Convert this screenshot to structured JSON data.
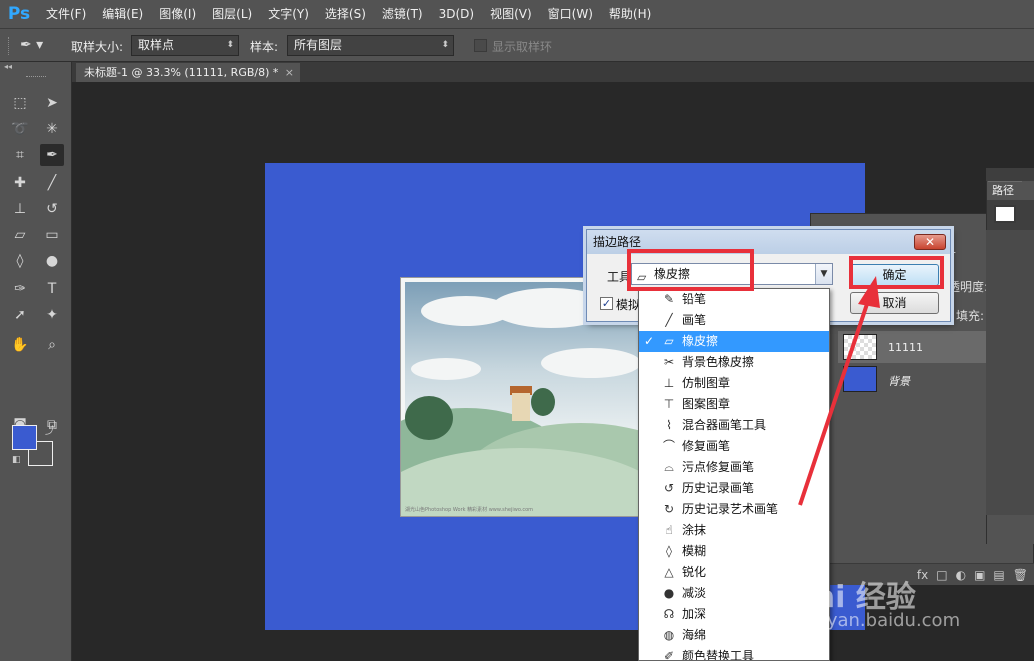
{
  "app": {
    "logo": "Ps",
    "menu": [
      "文件(F)",
      "编辑(E)",
      "图像(I)",
      "图层(L)",
      "文字(Y)",
      "选择(S)",
      "滤镜(T)",
      "3D(D)",
      "视图(V)",
      "窗口(W)",
      "帮助(H)"
    ]
  },
  "options": {
    "sample_size_label": "取样大小:",
    "sample_size_value": "取样点",
    "sample_label": "样本:",
    "sample_value": "所有图层",
    "show_ring_label": "显示取样环"
  },
  "document": {
    "tab_title": "未标题-1 @ 33.3% (11111, RGB/8) *",
    "close": "×",
    "photo_caption": "湖光山色Photoshop Work 精彩素材 www.shejiwo.com"
  },
  "panels": {
    "paths_tab": "路径",
    "opacity_label": "透明度:",
    "fill_label": "填充:",
    "layers": [
      {
        "name": "11111",
        "italic": false
      },
      {
        "name": "背景",
        "italic": true
      }
    ],
    "footer_icons": [
      "fx",
      "□",
      "◐",
      "▣",
      "▤",
      "🗑"
    ]
  },
  "dialog": {
    "title": "描边路径",
    "close": "✕",
    "tool_label": "工具:",
    "tool_value": "橡皮擦",
    "simulate_label": "模拟",
    "ok": "确定",
    "cancel": "取消"
  },
  "tool_list": {
    "selected_index": 2,
    "items": [
      {
        "label": "铅笔",
        "icon": "pencil-icon",
        "glyph": "✎"
      },
      {
        "label": "画笔",
        "icon": "brush-icon",
        "glyph": "╱"
      },
      {
        "label": "橡皮擦",
        "icon": "eraser-icon",
        "glyph": "▱"
      },
      {
        "label": "背景色橡皮擦",
        "icon": "background-eraser-icon",
        "glyph": "✂"
      },
      {
        "label": "仿制图章",
        "icon": "clone-stamp-icon",
        "glyph": "⊥"
      },
      {
        "label": "图案图章",
        "icon": "pattern-stamp-icon",
        "glyph": "⊤"
      },
      {
        "label": "混合器画笔工具",
        "icon": "mixer-brush-icon",
        "glyph": "⌇"
      },
      {
        "label": "修复画笔",
        "icon": "healing-brush-icon",
        "glyph": "⌒"
      },
      {
        "label": "污点修复画笔",
        "icon": "spot-healing-icon",
        "glyph": "⌓"
      },
      {
        "label": "历史记录画笔",
        "icon": "history-brush-icon",
        "glyph": "↺"
      },
      {
        "label": "历史记录艺术画笔",
        "icon": "art-history-brush-icon",
        "glyph": "↻"
      },
      {
        "label": "涂抹",
        "icon": "smudge-icon",
        "glyph": "☝"
      },
      {
        "label": "模糊",
        "icon": "blur-icon",
        "glyph": "◊"
      },
      {
        "label": "锐化",
        "icon": "sharpen-icon",
        "glyph": "△"
      },
      {
        "label": "减淡",
        "icon": "dodge-icon",
        "glyph": "●"
      },
      {
        "label": "加深",
        "icon": "burn-icon",
        "glyph": "☊"
      },
      {
        "label": "海绵",
        "icon": "sponge-icon",
        "glyph": "◍"
      },
      {
        "label": "颜色替换工具",
        "icon": "color-replace-icon",
        "glyph": "✐"
      }
    ]
  },
  "colors": {
    "foreground": "#3a5bd0",
    "canvas": "#3a5bd0",
    "highlight": "#e8303a",
    "selection": "#3399ff"
  },
  "watermark": {
    "main": "Bai 经验",
    "sub": "jingyan.baidu.com"
  }
}
